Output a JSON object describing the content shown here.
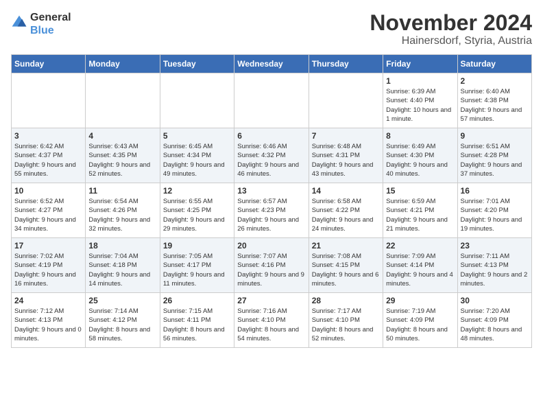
{
  "logo": {
    "text_general": "General",
    "text_blue": "Blue"
  },
  "title": "November 2024",
  "subtitle": "Hainersdorf, Styria, Austria",
  "days_of_week": [
    "Sunday",
    "Monday",
    "Tuesday",
    "Wednesday",
    "Thursday",
    "Friday",
    "Saturday"
  ],
  "weeks": [
    [
      {
        "day": "",
        "info": ""
      },
      {
        "day": "",
        "info": ""
      },
      {
        "day": "",
        "info": ""
      },
      {
        "day": "",
        "info": ""
      },
      {
        "day": "",
        "info": ""
      },
      {
        "day": "1",
        "info": "Sunrise: 6:39 AM\nSunset: 4:40 PM\nDaylight: 10 hours and 1 minute."
      },
      {
        "day": "2",
        "info": "Sunrise: 6:40 AM\nSunset: 4:38 PM\nDaylight: 9 hours and 57 minutes."
      }
    ],
    [
      {
        "day": "3",
        "info": "Sunrise: 6:42 AM\nSunset: 4:37 PM\nDaylight: 9 hours and 55 minutes."
      },
      {
        "day": "4",
        "info": "Sunrise: 6:43 AM\nSunset: 4:35 PM\nDaylight: 9 hours and 52 minutes."
      },
      {
        "day": "5",
        "info": "Sunrise: 6:45 AM\nSunset: 4:34 PM\nDaylight: 9 hours and 49 minutes."
      },
      {
        "day": "6",
        "info": "Sunrise: 6:46 AM\nSunset: 4:32 PM\nDaylight: 9 hours and 46 minutes."
      },
      {
        "day": "7",
        "info": "Sunrise: 6:48 AM\nSunset: 4:31 PM\nDaylight: 9 hours and 43 minutes."
      },
      {
        "day": "8",
        "info": "Sunrise: 6:49 AM\nSunset: 4:30 PM\nDaylight: 9 hours and 40 minutes."
      },
      {
        "day": "9",
        "info": "Sunrise: 6:51 AM\nSunset: 4:28 PM\nDaylight: 9 hours and 37 minutes."
      }
    ],
    [
      {
        "day": "10",
        "info": "Sunrise: 6:52 AM\nSunset: 4:27 PM\nDaylight: 9 hours and 34 minutes."
      },
      {
        "day": "11",
        "info": "Sunrise: 6:54 AM\nSunset: 4:26 PM\nDaylight: 9 hours and 32 minutes."
      },
      {
        "day": "12",
        "info": "Sunrise: 6:55 AM\nSunset: 4:25 PM\nDaylight: 9 hours and 29 minutes."
      },
      {
        "day": "13",
        "info": "Sunrise: 6:57 AM\nSunset: 4:23 PM\nDaylight: 9 hours and 26 minutes."
      },
      {
        "day": "14",
        "info": "Sunrise: 6:58 AM\nSunset: 4:22 PM\nDaylight: 9 hours and 24 minutes."
      },
      {
        "day": "15",
        "info": "Sunrise: 6:59 AM\nSunset: 4:21 PM\nDaylight: 9 hours and 21 minutes."
      },
      {
        "day": "16",
        "info": "Sunrise: 7:01 AM\nSunset: 4:20 PM\nDaylight: 9 hours and 19 minutes."
      }
    ],
    [
      {
        "day": "17",
        "info": "Sunrise: 7:02 AM\nSunset: 4:19 PM\nDaylight: 9 hours and 16 minutes."
      },
      {
        "day": "18",
        "info": "Sunrise: 7:04 AM\nSunset: 4:18 PM\nDaylight: 9 hours and 14 minutes."
      },
      {
        "day": "19",
        "info": "Sunrise: 7:05 AM\nSunset: 4:17 PM\nDaylight: 9 hours and 11 minutes."
      },
      {
        "day": "20",
        "info": "Sunrise: 7:07 AM\nSunset: 4:16 PM\nDaylight: 9 hours and 9 minutes."
      },
      {
        "day": "21",
        "info": "Sunrise: 7:08 AM\nSunset: 4:15 PM\nDaylight: 9 hours and 6 minutes."
      },
      {
        "day": "22",
        "info": "Sunrise: 7:09 AM\nSunset: 4:14 PM\nDaylight: 9 hours and 4 minutes."
      },
      {
        "day": "23",
        "info": "Sunrise: 7:11 AM\nSunset: 4:13 PM\nDaylight: 9 hours and 2 minutes."
      }
    ],
    [
      {
        "day": "24",
        "info": "Sunrise: 7:12 AM\nSunset: 4:13 PM\nDaylight: 9 hours and 0 minutes."
      },
      {
        "day": "25",
        "info": "Sunrise: 7:14 AM\nSunset: 4:12 PM\nDaylight: 8 hours and 58 minutes."
      },
      {
        "day": "26",
        "info": "Sunrise: 7:15 AM\nSunset: 4:11 PM\nDaylight: 8 hours and 56 minutes."
      },
      {
        "day": "27",
        "info": "Sunrise: 7:16 AM\nSunset: 4:10 PM\nDaylight: 8 hours and 54 minutes."
      },
      {
        "day": "28",
        "info": "Sunrise: 7:17 AM\nSunset: 4:10 PM\nDaylight: 8 hours and 52 minutes."
      },
      {
        "day": "29",
        "info": "Sunrise: 7:19 AM\nSunset: 4:09 PM\nDaylight: 8 hours and 50 minutes."
      },
      {
        "day": "30",
        "info": "Sunrise: 7:20 AM\nSunset: 4:09 PM\nDaylight: 8 hours and 48 minutes."
      }
    ]
  ]
}
